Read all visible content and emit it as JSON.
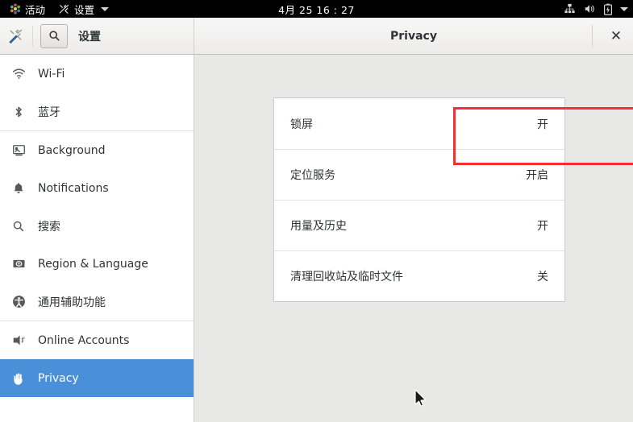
{
  "topbar": {
    "activities_label": "活动",
    "activities_icon": "gnome-activities-icon",
    "app_menu_label": "设置",
    "app_menu_icon": "settings-tools-icon",
    "app_menu_caret": "chevron-down-icon",
    "clock": "4月 25  16 : 27",
    "status_icons": [
      "network-wired-icon",
      "volume-icon",
      "battery-charging-icon",
      "chevron-down-icon"
    ]
  },
  "headerbar": {
    "app_icon": "tools-icon",
    "search_icon": "search-icon",
    "app_title": "设置",
    "panel_title": "Privacy",
    "close_label": "✕"
  },
  "sidebar": {
    "items": [
      {
        "label": "Wi-Fi",
        "icon": "wifi-icon",
        "selected": false
      },
      {
        "label": "蓝牙",
        "icon": "bluetooth-icon",
        "selected": false
      },
      {
        "separator_after": true
      },
      {
        "label": "Background",
        "icon": "background-icon",
        "selected": false
      },
      {
        "label": "Notifications",
        "icon": "bell-icon",
        "selected": false
      },
      {
        "label": "搜索",
        "icon": "search-icon",
        "selected": false
      },
      {
        "label": "Region & Language",
        "icon": "region-language-icon",
        "selected": false
      },
      {
        "label": "通用辅助功能",
        "icon": "universal-access-icon",
        "selected": false
      },
      {
        "separator_after": true
      },
      {
        "label": "Online Accounts",
        "icon": "online-accounts-icon",
        "selected": false
      },
      {
        "label": "Privacy",
        "icon": "hand-privacy-icon",
        "selected": true
      }
    ]
  },
  "content": {
    "rows": [
      {
        "label": "锁屏",
        "value": "开"
      },
      {
        "label": "定位服务",
        "value": "开启"
      },
      {
        "label": "用量及历史",
        "value": "开"
      },
      {
        "label": "清理回收站及临时文件",
        "value": "关"
      }
    ]
  },
  "annotation": {
    "color": "#f72f31",
    "target": "锁屏"
  },
  "colors": {
    "accent": "#4a90d9",
    "topbar_bg": "#000000",
    "content_bg": "#e8e8e7",
    "panel_bg": "#ffffff",
    "annotation": "#f72f31"
  }
}
